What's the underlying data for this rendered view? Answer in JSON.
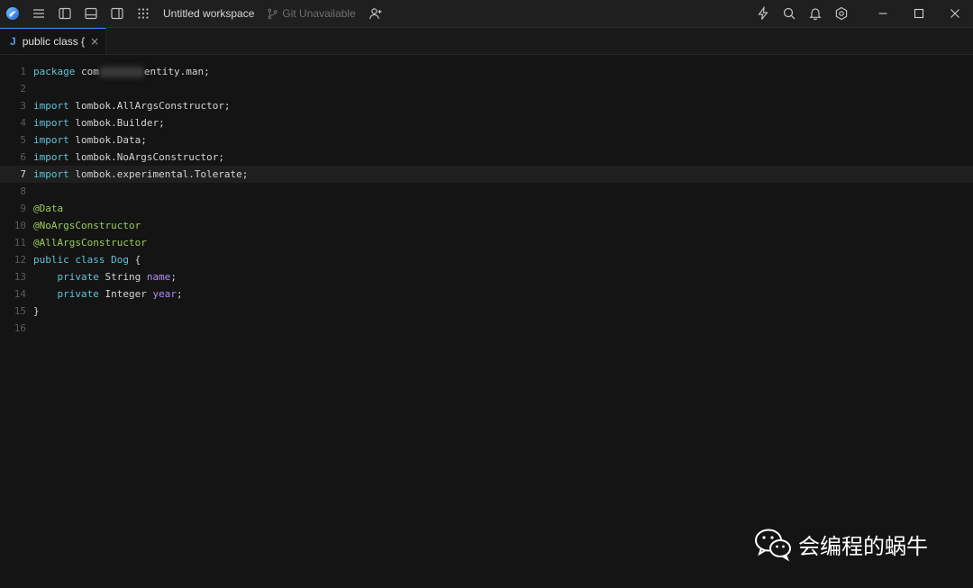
{
  "titlebar": {
    "workspace_title": "Untitled workspace",
    "git_status": "Git Unavailable",
    "icons_left": [
      "app-logo-icon",
      "menu-icon",
      "left-panel-icon",
      "bottom-panel-icon",
      "right-panel-icon",
      "apps-grid-icon"
    ],
    "icons_right": [
      "lightning-icon",
      "search-icon",
      "bell-icon",
      "settings-icon"
    ],
    "window_controls": [
      "minimize",
      "maximize",
      "close"
    ]
  },
  "tab": {
    "language_badge": "J",
    "title": "public class {",
    "close": "×"
  },
  "editor": {
    "active_line": 7,
    "lines": [
      {
        "n": "1",
        "segments": [
          {
            "t": "package",
            "c": "kw"
          },
          {
            "t": " com",
            "c": "plain"
          },
          {
            "t": "",
            "c": "blur"
          },
          {
            "t": "entity.man;",
            "c": "plain"
          }
        ]
      },
      {
        "n": "2",
        "segments": []
      },
      {
        "n": "3",
        "segments": [
          {
            "t": "import",
            "c": "kw"
          },
          {
            "t": " lombok.AllArgsConstructor;",
            "c": "plain"
          }
        ]
      },
      {
        "n": "4",
        "segments": [
          {
            "t": "import",
            "c": "kw"
          },
          {
            "t": " lombok.Builder;",
            "c": "plain"
          }
        ]
      },
      {
        "n": "5",
        "segments": [
          {
            "t": "import",
            "c": "kw"
          },
          {
            "t": " lombok.Data;",
            "c": "plain"
          }
        ]
      },
      {
        "n": "6",
        "segments": [
          {
            "t": "import",
            "c": "kw"
          },
          {
            "t": " lombok.NoArgsConstructor;",
            "c": "plain"
          }
        ]
      },
      {
        "n": "7",
        "segments": [
          {
            "t": "import",
            "c": "kw"
          },
          {
            "t": " lombok.experimental.Tolerate;",
            "c": "plain"
          }
        ]
      },
      {
        "n": "8",
        "segments": []
      },
      {
        "n": "9",
        "segments": [
          {
            "t": "@Data",
            "c": "ann"
          }
        ]
      },
      {
        "n": "10",
        "segments": [
          {
            "t": "@NoArgsConstructor",
            "c": "ann"
          }
        ]
      },
      {
        "n": "11",
        "segments": [
          {
            "t": "@AllArgsConstructor",
            "c": "ann"
          }
        ]
      },
      {
        "n": "12",
        "segments": [
          {
            "t": "public",
            "c": "kw"
          },
          {
            "t": " ",
            "c": "plain"
          },
          {
            "t": "class",
            "c": "kw"
          },
          {
            "t": " ",
            "c": "plain"
          },
          {
            "t": "Dog",
            "c": "kw"
          },
          {
            "t": " {",
            "c": "plain"
          }
        ]
      },
      {
        "n": "13",
        "segments": [
          {
            "t": "    ",
            "c": "plain"
          },
          {
            "t": "private",
            "c": "kw"
          },
          {
            "t": " String ",
            "c": "plain"
          },
          {
            "t": "name",
            "c": "var"
          },
          {
            "t": ";",
            "c": "plain"
          }
        ]
      },
      {
        "n": "14",
        "segments": [
          {
            "t": "    ",
            "c": "plain"
          },
          {
            "t": "private",
            "c": "kw"
          },
          {
            "t": " Integer ",
            "c": "plain"
          },
          {
            "t": "year",
            "c": "var"
          },
          {
            "t": ";",
            "c": "plain"
          }
        ]
      },
      {
        "n": "15",
        "segments": [
          {
            "t": "}",
            "c": "plain"
          }
        ]
      },
      {
        "n": "16",
        "segments": []
      }
    ]
  },
  "watermark": {
    "text": "会编程的蜗牛"
  },
  "colors": {
    "keyword": "#5ec4d8",
    "annotation": "#9ccc5a",
    "variable": "#b38cf5",
    "accent": "#3b82f6"
  }
}
